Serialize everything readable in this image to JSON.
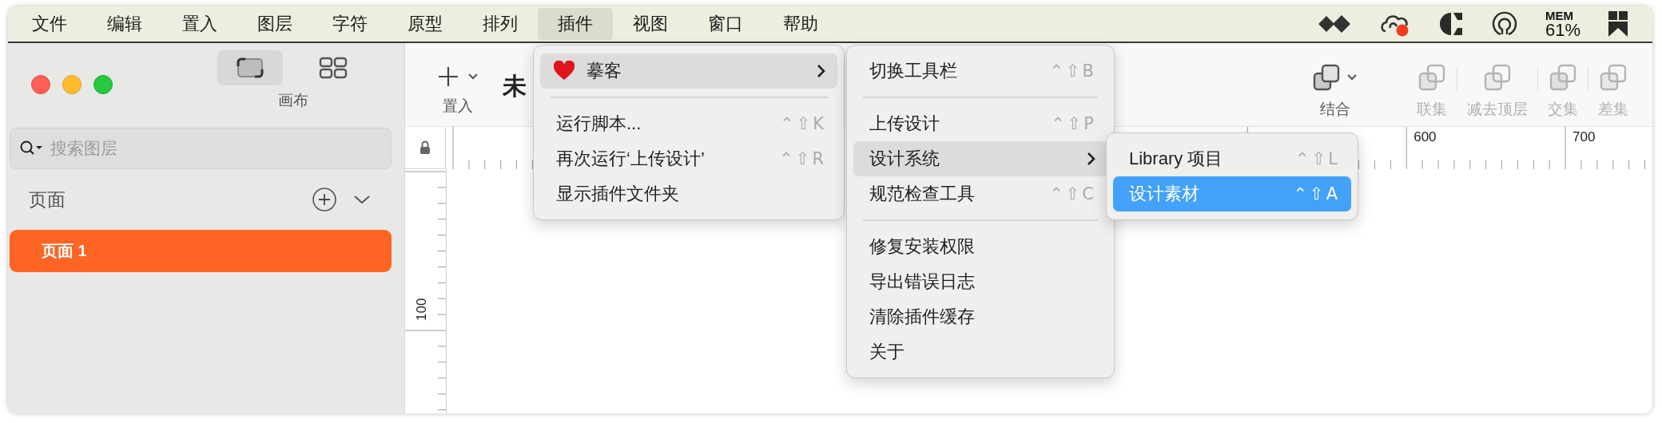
{
  "menubar": {
    "menus": [
      {
        "label": "文件",
        "selected": false
      },
      {
        "label": "编辑",
        "selected": false
      },
      {
        "label": "置入",
        "selected": false
      },
      {
        "label": "图层",
        "selected": false
      },
      {
        "label": "字符",
        "selected": false
      },
      {
        "label": "原型",
        "selected": false
      },
      {
        "label": "排列",
        "selected": false
      },
      {
        "label": "插件",
        "selected": true
      },
      {
        "label": "视图",
        "selected": false
      },
      {
        "label": "窗口",
        "selected": false
      },
      {
        "label": "帮助",
        "selected": false
      }
    ],
    "mem": {
      "label": "MEM",
      "value": "61%"
    }
  },
  "sidebar": {
    "view_modes": [
      {
        "kind": "canvas",
        "selected": true
      },
      {
        "kind": "grid",
        "selected": false
      }
    ],
    "view_label": "画布",
    "search": {
      "placeholder": "搜索图层"
    },
    "pages_title": "页面",
    "pages": [
      {
        "label": "页面 1",
        "selected": true
      }
    ]
  },
  "toolbar": {
    "insert_label": "置入",
    "document_title": "未",
    "tools": [
      {
        "kind": "combine",
        "label": "结合",
        "disabled": false
      },
      {
        "kind": "union",
        "label": "联集",
        "disabled": true
      },
      {
        "kind": "subtract",
        "label": "减去顶层",
        "disabled": true
      },
      {
        "kind": "intersect",
        "label": "交集",
        "disabled": true
      },
      {
        "kind": "difference",
        "label": "差集",
        "disabled": true
      }
    ]
  },
  "ruler": {
    "top_labels": [
      "600",
      "700"
    ],
    "left_labels": [
      "100"
    ]
  },
  "menus": [
    {
      "items": [
        {
          "kind": "plugin",
          "label": "摹客",
          "selected": true
        },
        {
          "kind": "separator"
        },
        {
          "kind": "item",
          "label": "运行脚本...",
          "shortcut": "⌃⇧K",
          "selected": false
        },
        {
          "kind": "item",
          "label": "再次运行‘上传设计’",
          "shortcut": "⌃⇧R",
          "selected": false
        },
        {
          "kind": "item",
          "label": "显示插件文件夹",
          "selected": false
        }
      ]
    },
    {
      "items": [
        {
          "kind": "item",
          "label": "切换工具栏",
          "shortcut": "⌃⇧B",
          "selected": false
        },
        {
          "kind": "separator"
        },
        {
          "kind": "item",
          "label": "上传设计",
          "shortcut": "⌃⇧P",
          "selected": false
        },
        {
          "kind": "submenu",
          "label": "设计系统",
          "selected": true
        },
        {
          "kind": "item",
          "label": "规范检查工具",
          "shortcut": "⌃⇧C",
          "selected": false
        },
        {
          "kind": "separator"
        },
        {
          "kind": "item",
          "label": "修复安装权限",
          "selected": false
        },
        {
          "kind": "item",
          "label": "导出错误日志",
          "selected": false
        },
        {
          "kind": "item",
          "label": "清除插件缓存",
          "selected": false
        },
        {
          "kind": "item",
          "label": "关于",
          "selected": false
        }
      ]
    },
    {
      "items": [
        {
          "kind": "item",
          "label": "Library 项目",
          "shortcut": "⌃⇧L",
          "selected": false
        },
        {
          "kind": "item",
          "label": "设计素材",
          "shortcut": "⌃⇧A",
          "selected": true
        }
      ]
    }
  ]
}
